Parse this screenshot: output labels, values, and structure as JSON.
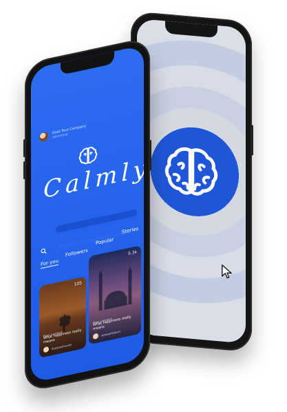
{
  "front_app": {
    "profile": {
      "company": "Dust Tour Company",
      "role": "advertising"
    },
    "logo_text": "Calmly",
    "tabs": [
      {
        "label": "For you"
      },
      {
        "label": "Followers"
      },
      {
        "label": "Popular"
      },
      {
        "label": "Stories"
      }
    ],
    "cards": [
      {
        "count": "105",
        "subtitle": "Rose Lambert",
        "title": "What happiness really means",
        "user": "ilyaspazhvand"
      },
      {
        "count": "5.3k",
        "subtitle": "Rose Lambert",
        "title": "What happiness really means",
        "user": "sorwanfrohert"
      }
    ]
  },
  "back_app": {
    "center_icon": "brain-icon"
  },
  "colors": {
    "primary_blue": "#2c6df2",
    "deep_blue": "#1f56d8",
    "ring_light": "#d6dbe4"
  }
}
